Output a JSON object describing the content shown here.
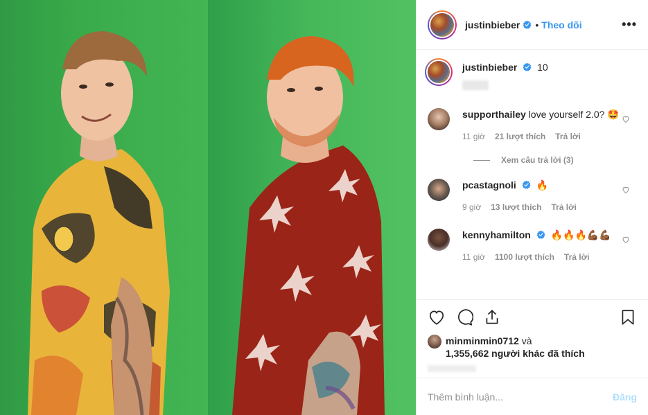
{
  "header": {
    "username": "justinbieber",
    "follow_label": "Theo dõi",
    "more_label": "•••"
  },
  "caption": {
    "username": "justinbieber",
    "text": "10"
  },
  "comments": [
    {
      "username": "supporthailey",
      "text": "love yourself 2.0? 🤩",
      "time": "11 giờ",
      "likes": "21 lượt thích",
      "reply": "Trả lời",
      "verified": false
    },
    {
      "username": "pcastagnoli",
      "text": "🔥",
      "time": "9 giờ",
      "likes": "13 lượt thích",
      "reply": "Trả lời",
      "verified": true
    },
    {
      "username": "kennyhamilton",
      "text": "🔥🔥🔥💪🏾💪🏾",
      "time": "11 giờ",
      "likes": "1100 lượt thích",
      "reply": "Trả lời",
      "verified": true
    }
  ],
  "view_replies": "Xem câu trả lời (3)",
  "likes": {
    "first_user": "minminmin0712",
    "connector": "và",
    "count_text": "1,355,662 người khác đã thích"
  },
  "comment_box": {
    "placeholder": "Thêm bình luận...",
    "post_label": "Đăng"
  },
  "colors": {
    "link_blue": "#3897f0",
    "post_disabled": "#b2dffc",
    "green_screen": "#3aab4b"
  },
  "icons": [
    "heart-icon",
    "comment-icon",
    "share-icon",
    "bookmark-icon",
    "verified-badge-icon",
    "more-icon"
  ]
}
